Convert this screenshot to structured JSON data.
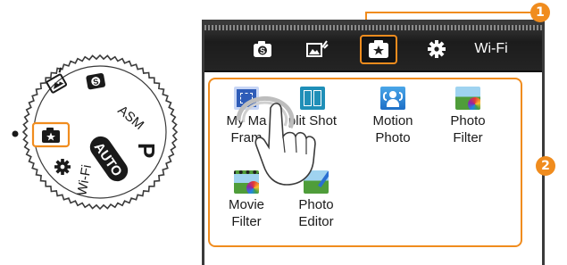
{
  "dial": {
    "labels": {
      "p": "P",
      "auto": "AUTO",
      "asm": "ASM",
      "wifi": "Wi-Fi"
    },
    "selected_icon": "star-mode-icon"
  },
  "screen": {
    "tabs": [
      {
        "name": "smart-mode",
        "icon": "smart-s-icon"
      },
      {
        "name": "scene",
        "icon": "scene-frame-icon"
      },
      {
        "name": "magic-plus",
        "icon": "star-icon",
        "selected": true
      },
      {
        "name": "settings",
        "icon": "gear-icon"
      },
      {
        "name": "wifi",
        "label": "Wi-Fi"
      }
    ],
    "modes": [
      {
        "label": "My Ma\nFram",
        "icon": "my-magic-frame-icon"
      },
      {
        "label": "plit Shot",
        "icon": "split-shot-icon"
      },
      {
        "label": "Motion\nPhoto",
        "icon": "motion-photo-icon"
      },
      {
        "label": "Photo\nFilter",
        "icon": "photo-filter-icon"
      },
      {
        "label": "Movie\nFilter",
        "icon": "movie-filter-icon"
      },
      {
        "label": "Photo\nEditor",
        "icon": "photo-editor-icon"
      }
    ]
  },
  "callouts": {
    "one": "1",
    "two": "2"
  },
  "colors": {
    "accent": "#f08c1e",
    "toolbar": "#222222",
    "frame": "#3a3a3a"
  }
}
